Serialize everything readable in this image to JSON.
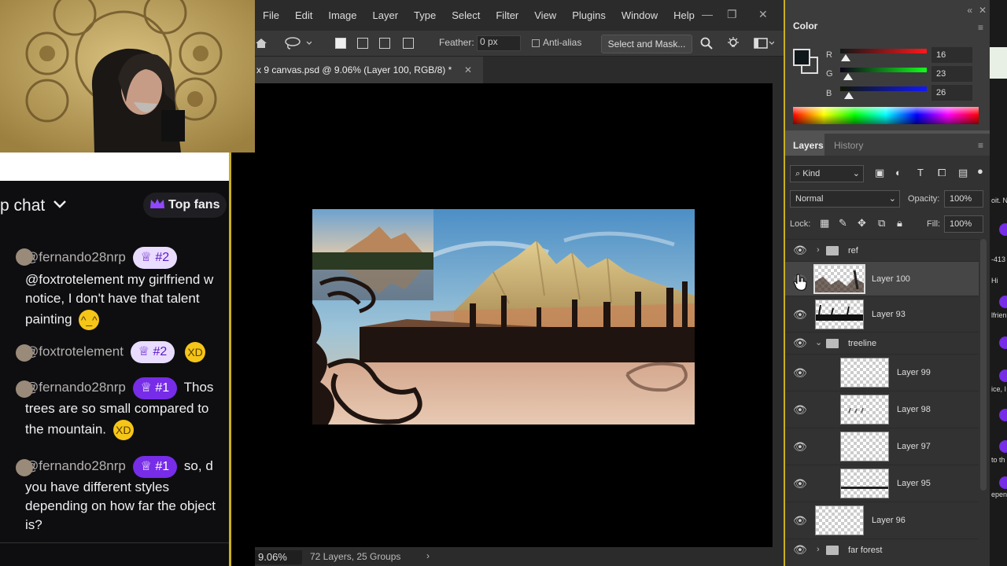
{
  "chat": {
    "title": "p chat",
    "top_fans_label": "Top fans",
    "messages": [
      {
        "user": "@fernando28nrp",
        "badge": "#2",
        "text_lines": [
          "@foxtrotelement my girlfriend w",
          "notice, I don't have that talent",
          "painting"
        ]
      },
      {
        "user": "@foxtrotelement",
        "badge": "#2",
        "text_lines": []
      },
      {
        "user": "@fernando28nrp",
        "badge": "#1",
        "text_lines": [
          "Thos",
          "trees are so small compared to",
          "the mountain."
        ]
      },
      {
        "user": "@fernando28nrp",
        "badge": "#1",
        "text_lines": [
          "so, d",
          "you have different styles",
          "depending on how far the object",
          "is?"
        ]
      }
    ]
  },
  "photoshop": {
    "menu": [
      "File",
      "Edit",
      "Image",
      "Layer",
      "Type",
      "Select",
      "Filter",
      "View",
      "Plugins",
      "Window",
      "Help"
    ],
    "options": {
      "feather_label": "Feather:",
      "feather_value": "0 px",
      "antialias_label": "Anti-alias",
      "select_mask_label": "Select and Mask..."
    },
    "doc_tab": "x 9 canvas.psd @ 9.06% (Layer 100, RGB/8) *",
    "status": {
      "zoom": "9.06%",
      "info": "72 Layers, 25 Groups"
    }
  },
  "color_panel": {
    "tab": "Color",
    "r_label": "R",
    "g_label": "G",
    "b_label": "B",
    "r": "16",
    "g": "23",
    "b": "26",
    "r_frac": 0.063,
    "g_frac": 0.09,
    "b_frac": 0.102,
    "fg_color": "#10171a"
  },
  "layers_panel": {
    "tabs": [
      "Layers",
      "History"
    ],
    "filter_kind": "Kind",
    "blend_mode": "Normal",
    "opacity_label": "Opacity:",
    "opacity_value": "100%",
    "lock_label": "Lock:",
    "fill_label": "Fill:",
    "fill_value": "100%",
    "layers": [
      {
        "name": "ref",
        "type": "group"
      },
      {
        "name": "Layer 100",
        "type": "layer",
        "selected": true
      },
      {
        "name": "Layer 93",
        "type": "layer"
      },
      {
        "name": "treeline",
        "type": "group",
        "open": true
      },
      {
        "name": "Layer 99",
        "type": "layer",
        "indent": true
      },
      {
        "name": "Layer 98",
        "type": "layer",
        "indent": true
      },
      {
        "name": "Layer 97",
        "type": "layer",
        "indent": true
      },
      {
        "name": "Layer 95",
        "type": "layer",
        "indent": true
      },
      {
        "name": "Layer 96",
        "type": "layer"
      },
      {
        "name": "far forest",
        "type": "group"
      }
    ]
  },
  "strip": {
    "texts": [
      "oit. N",
      "-413",
      "Hi",
      "lfrien",
      "ice, I",
      "to th",
      "epen"
    ]
  },
  "colors": {
    "accent_gold": "#c9b020",
    "twitch_purple": "#772ce8",
    "badge_light": "#e9dcff"
  }
}
